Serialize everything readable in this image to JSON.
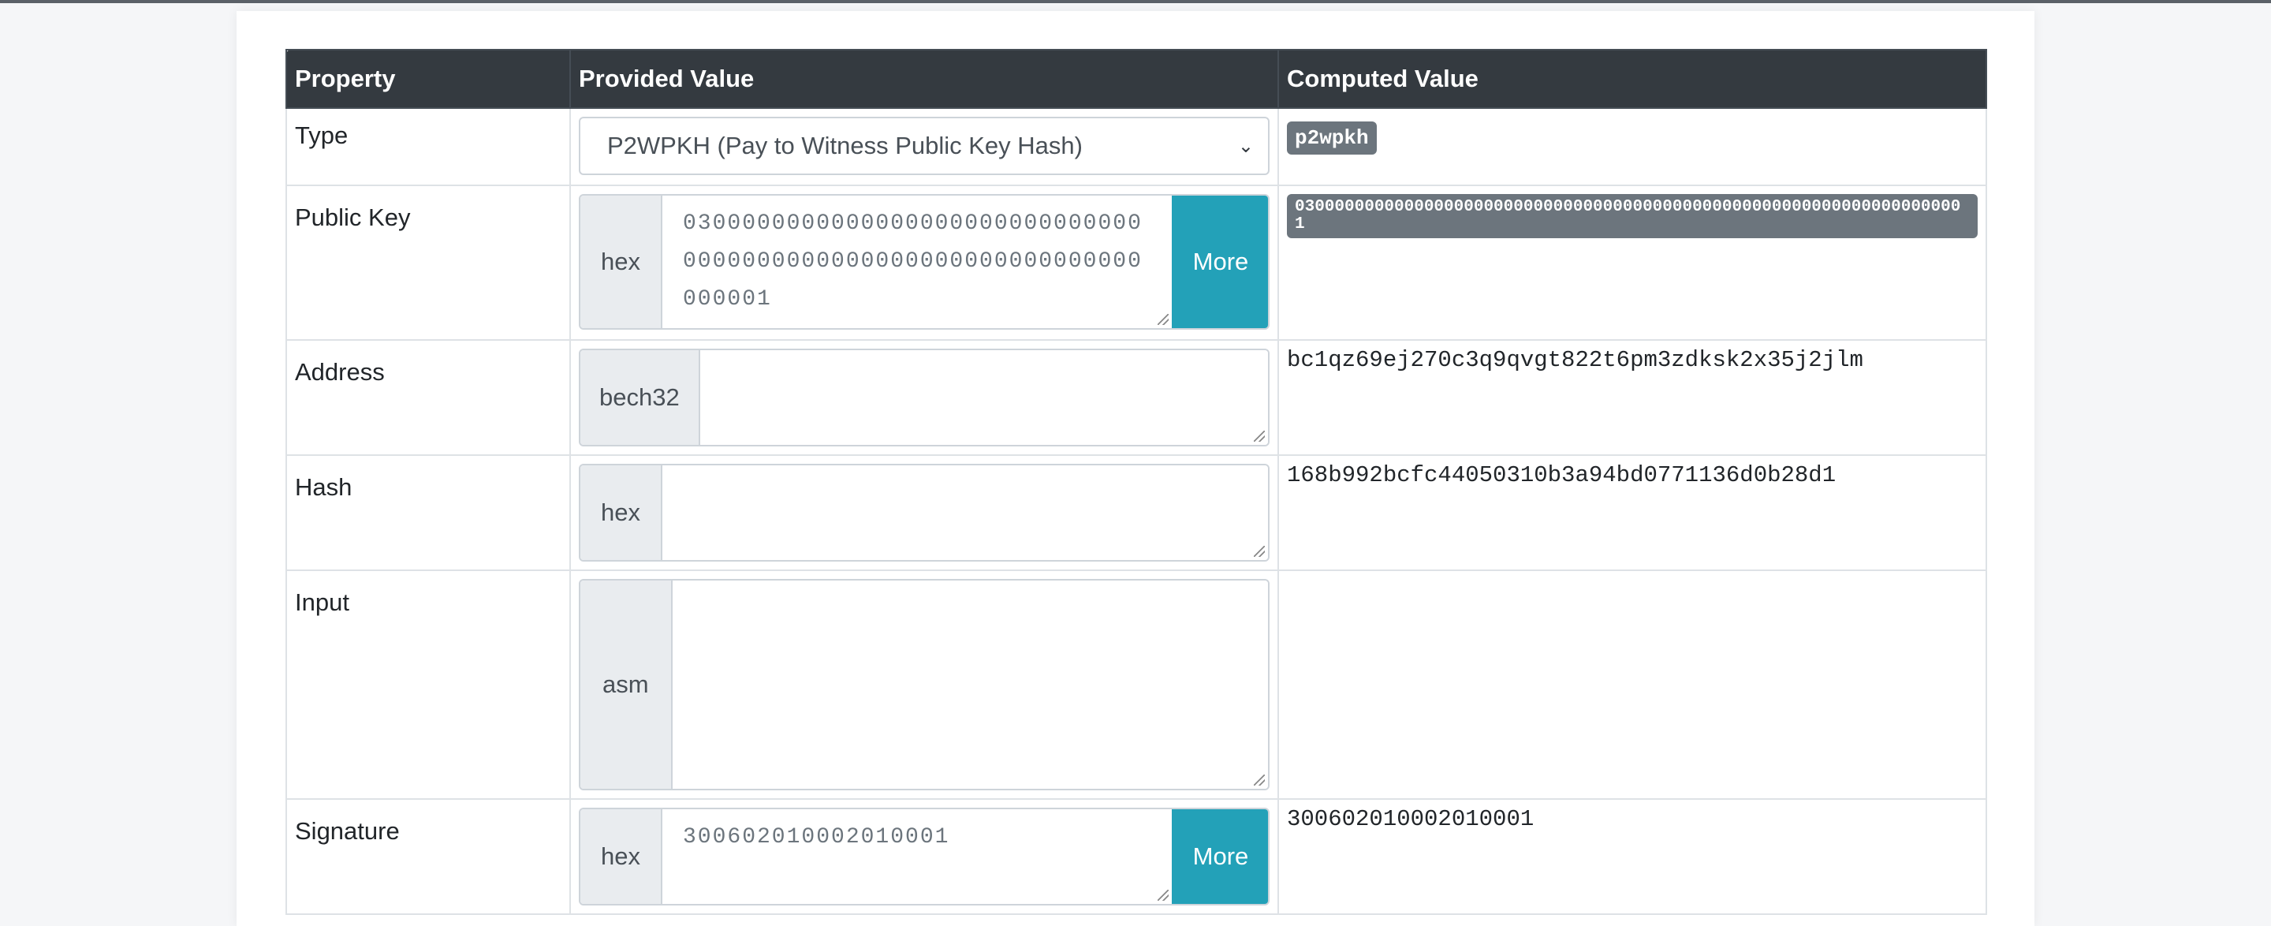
{
  "headers": {
    "property": "Property",
    "provided": "Provided Value",
    "computed": "Computed Value"
  },
  "rows": {
    "type": {
      "label": "Type",
      "selected": "P2WPKH (Pay to Witness Public Key Hash)",
      "computed": "p2wpkh"
    },
    "public_key": {
      "label": "Public Key",
      "prefix": "hex",
      "value": "03000000000000000000000000000000000000000000000000000000000000000001",
      "button": "More",
      "computed": "03000000000000000000000000000000000000000000000000000000000000000001"
    },
    "address": {
      "label": "Address",
      "prefix": "bech32",
      "value": "",
      "computed": "bc1qz69ej270c3q9qvgt822t6pm3zdksk2x35j2jlm"
    },
    "hash": {
      "label": "Hash",
      "prefix": "hex",
      "value": "",
      "computed": "168b992bcfc44050310b3a94bd0771136d0b28d1"
    },
    "input": {
      "label": "Input",
      "prefix": "asm",
      "value": "",
      "computed": ""
    },
    "signature": {
      "label": "Signature",
      "prefix": "hex",
      "value": "300602010002010001",
      "button": "More",
      "computed": "300602010002010001"
    }
  },
  "icons": {
    "select_arrow": "chevron-down-icon",
    "resize": "resize-grip-icon"
  },
  "colors": {
    "header_bg": "#343a40",
    "more_button": "#23a1b8",
    "badge": "#6c757d"
  }
}
